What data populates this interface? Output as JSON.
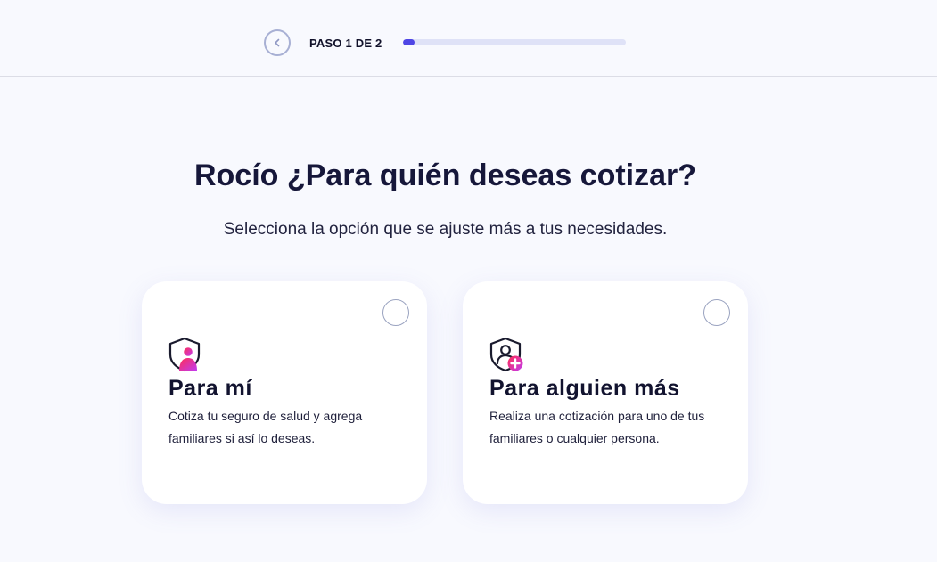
{
  "header": {
    "step_label": "PASO 1 DE 2",
    "progress_fraction": 0.05,
    "progress_color": "#4f46e5",
    "back_icon": "chevron-left-icon"
  },
  "main": {
    "title": "Rocío ¿Para quién deseas cotizar?",
    "subtitle": "Selecciona la opción que se ajuste más a tus necesidades."
  },
  "options": [
    {
      "icon": "shield-person-icon",
      "title": "Para mí",
      "description": "Cotiza tu seguro de salud y agrega familiares si así lo deseas.",
      "selected": false
    },
    {
      "icon": "shield-person-add-icon",
      "title": "Para alguien más",
      "description": "Realiza una cotización para uno de tus familiares o cualquier persona.",
      "selected": false
    }
  ]
}
